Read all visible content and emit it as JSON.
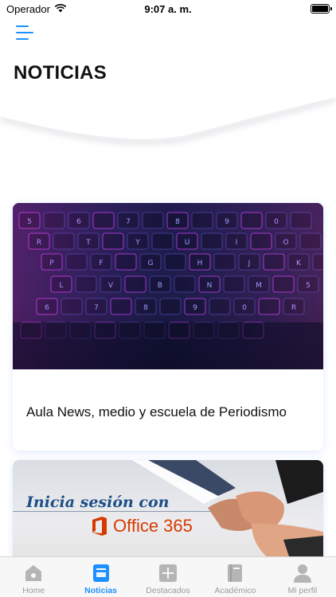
{
  "status_bar": {
    "carrier": "Operador",
    "time": "9:07 a. m.",
    "wifi_icon": "wifi-icon",
    "battery_level": 1.0
  },
  "header": {
    "menu_icon": "hamburger-menu-icon",
    "title": "NOTICIAS"
  },
  "news": [
    {
      "title": "Aula News, medio y escuela de Periodismo",
      "image": "keyboard-photo"
    },
    {
      "title": "",
      "image": "office365-login-banner",
      "banner_text": "Inicia sesión con",
      "banner_brand": "Office 365"
    }
  ],
  "tab_bar": {
    "active": "Noticias",
    "items": [
      {
        "label": "Home",
        "icon": "home-icon"
      },
      {
        "label": "Noticias",
        "icon": "newspaper-icon"
      },
      {
        "label": "Destacados",
        "icon": "plus-square-icon"
      },
      {
        "label": "Académico",
        "icon": "book-icon"
      },
      {
        "label": "Mi perfil",
        "icon": "user-icon"
      }
    ]
  },
  "colors": {
    "accent": "#1e90ff",
    "inactive": "#9b9b9b",
    "office_orange": "#d63a00",
    "banner_blue": "#1d4e86"
  }
}
